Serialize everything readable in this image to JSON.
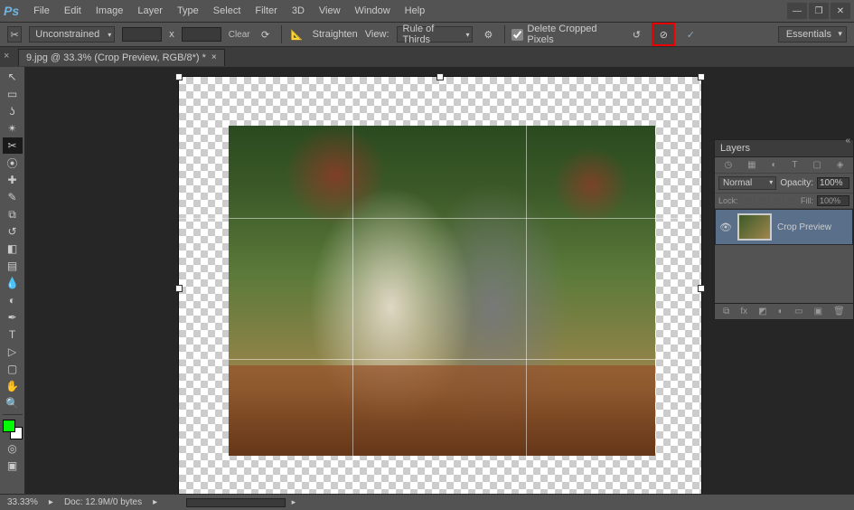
{
  "app": {
    "logo": "Ps"
  },
  "menu": {
    "items": [
      "File",
      "Edit",
      "Image",
      "Layer",
      "Type",
      "Select",
      "Filter",
      "3D",
      "View",
      "Window",
      "Help"
    ]
  },
  "window_controls": {
    "min": "—",
    "max": "❐",
    "close": "✕"
  },
  "options": {
    "aspect_label": "Unconstrained",
    "width": "",
    "x": "x",
    "height": "",
    "clear": "Clear",
    "straighten": "Straighten",
    "view_label": "View:",
    "overlay": "Rule of Thirds",
    "delete_cropped": "Delete Cropped Pixels",
    "workspace": "Essentials"
  },
  "tab": {
    "title": "9.jpg @ 33.3% (Crop Preview, RGB/8*) *"
  },
  "layers": {
    "panel_title": "Layers",
    "blend_mode": "Normal",
    "opacity_label": "Opacity:",
    "opacity_value": "100%",
    "lock_label": "Lock:",
    "fill_label": "Fill:",
    "fill_value": "100%",
    "items": [
      {
        "name": "Crop Preview"
      }
    ]
  },
  "status": {
    "zoom": "33.33%",
    "doc": "Doc: 12.9M/0 bytes"
  },
  "tools": {
    "list": [
      "move",
      "marquee",
      "lasso",
      "magic-wand",
      "crop",
      "eyedropper",
      "healing",
      "brush",
      "clone",
      "history-brush",
      "eraser",
      "gradient",
      "blur",
      "dodge",
      "pen",
      "type",
      "path-select",
      "rectangle",
      "hand",
      "zoom"
    ]
  }
}
